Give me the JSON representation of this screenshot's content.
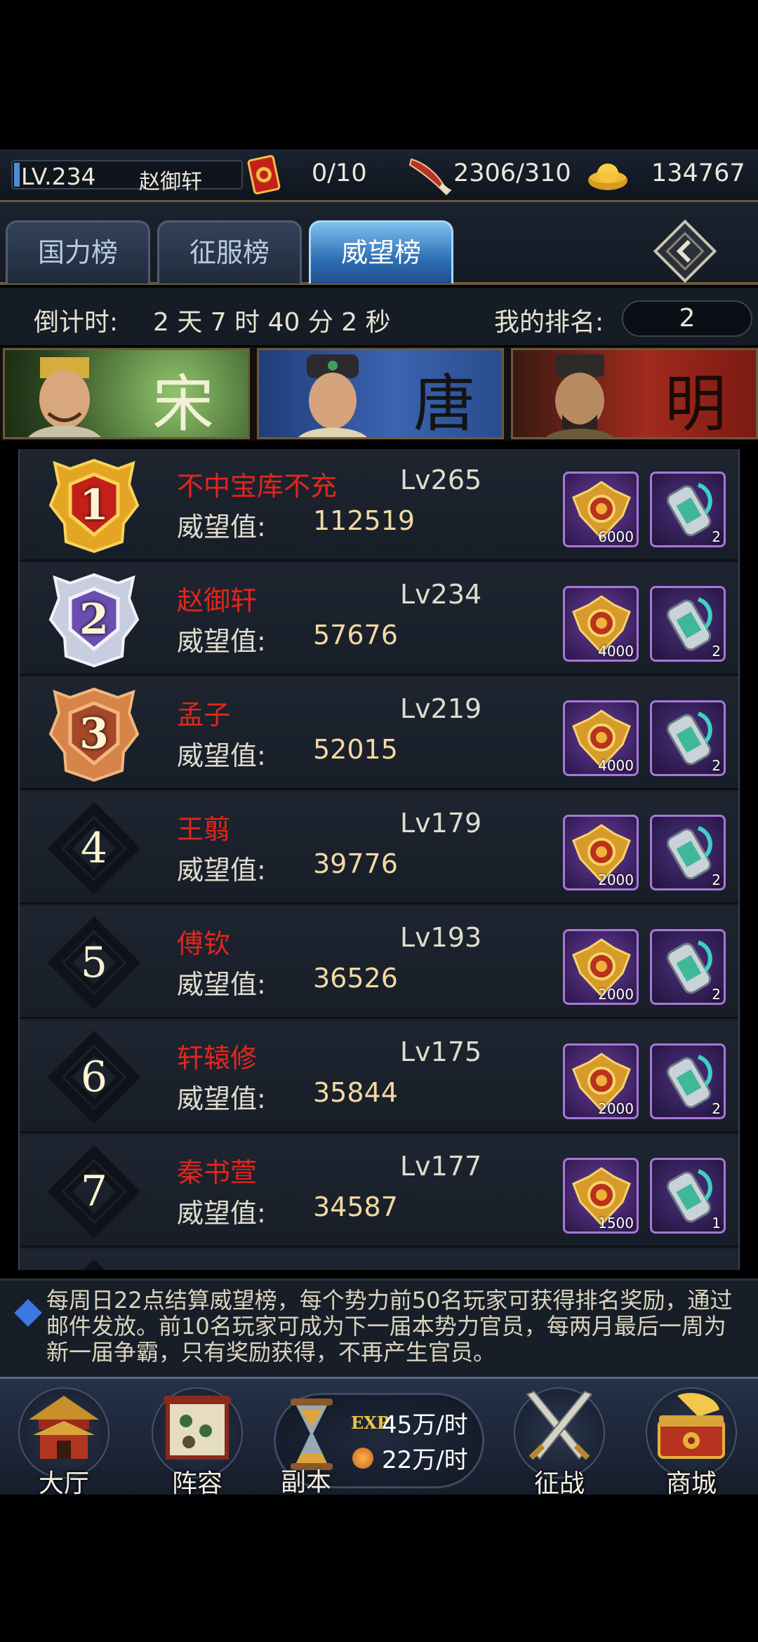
{
  "status_bar": {
    "level": "LV.234",
    "player_name": "赵御轩",
    "tokens": "0/10",
    "stamina": "2306/310",
    "gold": "134767",
    "icons": [
      "red-token-icon",
      "horn-icon",
      "gold-ingot-icon"
    ]
  },
  "tabs": [
    {
      "label": "国力榜",
      "active": false
    },
    {
      "label": "征服榜",
      "active": false
    },
    {
      "label": "威望榜",
      "active": true
    }
  ],
  "countdown": {
    "label": "倒计时:",
    "value": "2 天 7 时 40 分 2 秒"
  },
  "my_rank": {
    "label": "我的排名:",
    "value": "2"
  },
  "dynasties": [
    {
      "name": "宋",
      "color": "#f3f0d8"
    },
    {
      "name": "唐",
      "color": "#141414"
    },
    {
      "name": "明",
      "color": "#1a0b08"
    }
  ],
  "ranking": {
    "score_label": "威望值:",
    "rows": [
      {
        "rank": "1",
        "name": "不中宝库不充",
        "level": "Lv265",
        "score": "112519",
        "reward1": "6000",
        "reward2": "2"
      },
      {
        "rank": "2",
        "name": "赵御轩",
        "level": "Lv234",
        "score": "57676",
        "reward1": "4000",
        "reward2": "2"
      },
      {
        "rank": "3",
        "name": "孟子",
        "level": "Lv219",
        "score": "52015",
        "reward1": "4000",
        "reward2": "2"
      },
      {
        "rank": "4",
        "name": "王翦",
        "level": "Lv179",
        "score": "39776",
        "reward1": "2000",
        "reward2": "2"
      },
      {
        "rank": "5",
        "name": "傅钦",
        "level": "Lv193",
        "score": "36526",
        "reward1": "2000",
        "reward2": "2"
      },
      {
        "rank": "6",
        "name": "轩辕修",
        "level": "Lv175",
        "score": "35844",
        "reward1": "2000",
        "reward2": "2"
      },
      {
        "rank": "7",
        "name": "秦书萱",
        "level": "Lv177",
        "score": "34587",
        "reward1": "1500",
        "reward2": "1"
      }
    ]
  },
  "note": "每周日22点结算威望榜，每个势力前50名玩家可获得排名奖励，通过邮件发放。前10名玩家可成为下一届本势力官员，每两月最后一周为新一届争霸，只有奖励获得，不再产生官员。",
  "nav": {
    "hall": "大厅",
    "lineup": "阵容",
    "dungeon": "副本",
    "exp_label": "EXP",
    "exp_rate": "45万/时",
    "coin_rate": "22万/时",
    "campaign": "征战",
    "shop": "商城"
  }
}
